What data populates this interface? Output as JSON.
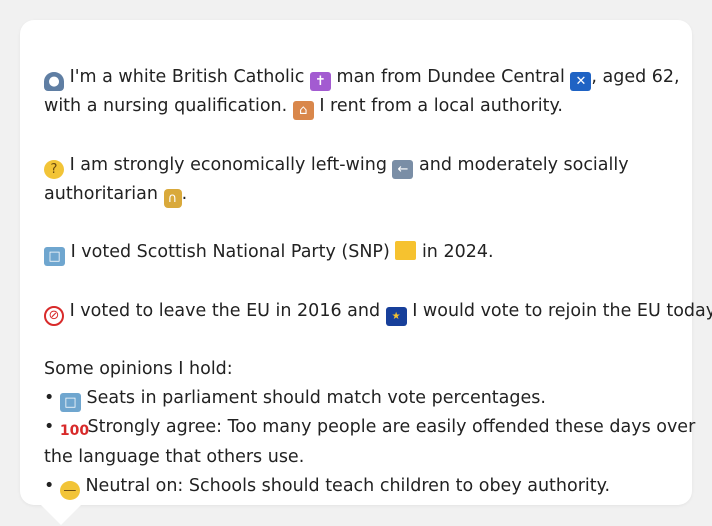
{
  "message": {
    "identity": {
      "icon_1": "person-icon",
      "text_1": " I'm a white British Catholic ",
      "icon_2": "latin-cross-icon",
      "text_2": " man from Dundee Central ",
      "icon_3": "scotland-flag-icon",
      "text_3": ", aged 62,",
      "line2_text_1": "with a nursing qualification. ",
      "icon_4": "house-icon",
      "line2_text_2": " I rent from a local authority."
    },
    "ideology": {
      "icon_1": "thinking-face-icon",
      "text_1": " I am strongly economically left-wing ",
      "icon_2": "left-arrow-icon",
      "text_2": " and moderately socially",
      "line2_text_1": "authoritarian ",
      "icon_3": "lock-icon",
      "line2_text_2": "."
    },
    "vote": {
      "icon_1": "ballot-box-icon",
      "text_1": " I voted Scottish National Party (SNP) ",
      "icon_2": "yellow-square-icon",
      "text_2": " in 2024."
    },
    "eu": {
      "icon_1": "prohibited-icon",
      "text_1": " I voted to leave the EU in 2016 and ",
      "icon_2": "eu-flag-icon",
      "text_2": " I would vote to rejoin the EU today."
    },
    "opinions_heading": "Some opinions I hold:",
    "opinions": [
      {
        "bullet": "•",
        "icon": "ballot-box-icon",
        "text": " Seats in parliament should match vote percentages."
      },
      {
        "bullet": "•",
        "icon": "hundred-points-icon",
        "text": " Strongly agree: Too many people are easily offended these days over",
        "text_cont": "the language that others use."
      },
      {
        "bullet": "•",
        "icon": "neutral-face-icon",
        "text": " Neutral on: Schools should teach children to obey authority."
      }
    ]
  }
}
